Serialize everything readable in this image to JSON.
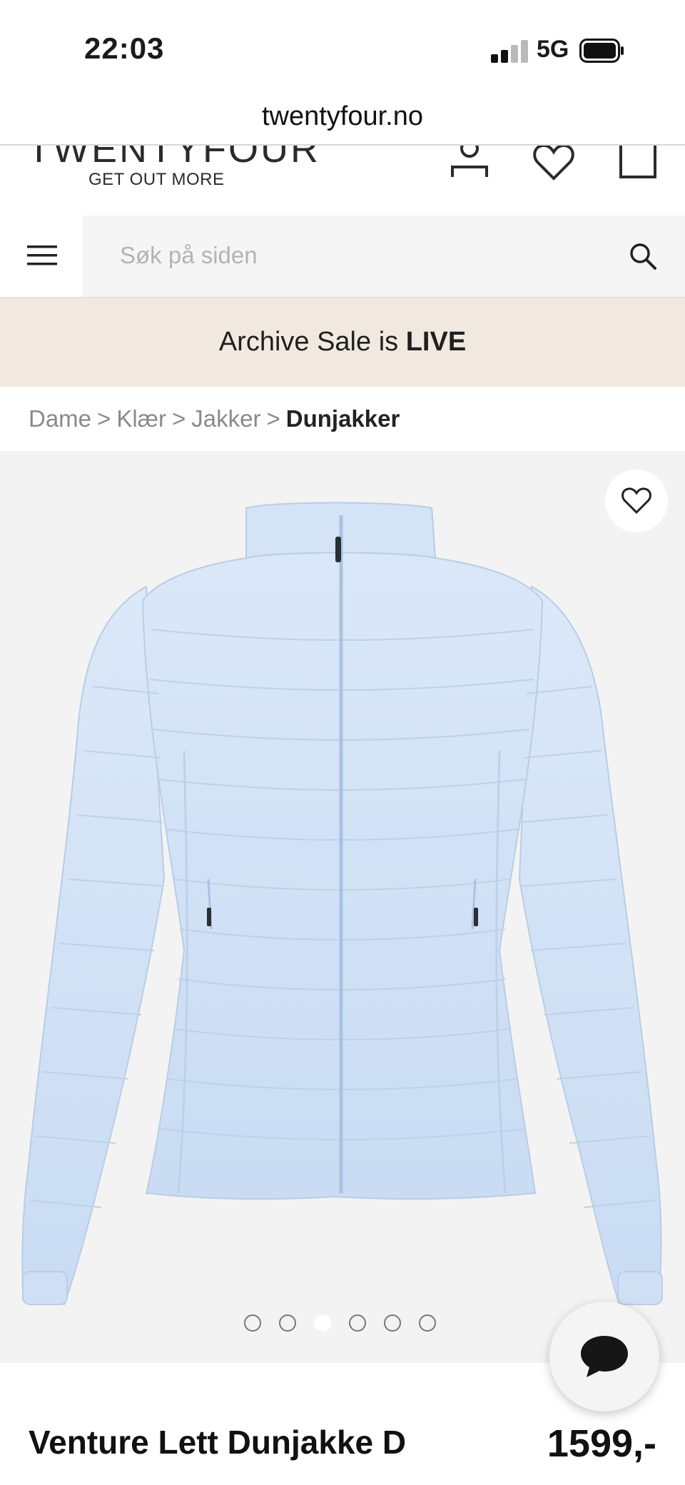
{
  "status_bar": {
    "time": "22:03",
    "network": "5G",
    "icons": [
      "signal-icon",
      "battery-icon"
    ]
  },
  "browser": {
    "url": "twentyfour.no"
  },
  "header": {
    "logo_text": "TWENTYFOUR",
    "tagline": "GET OUT MORE",
    "icons": [
      "account-icon",
      "heart-icon",
      "bag-icon"
    ]
  },
  "search": {
    "placeholder": "Søk på siden",
    "value": "",
    "icons": [
      "menu-icon",
      "search-icon"
    ]
  },
  "banner": {
    "text": "Archive Sale is",
    "highlight": "LIVE",
    "background": "#f1e9e0"
  },
  "breadcrumb": {
    "items": [
      "Dame",
      "Klær",
      "Jakker"
    ],
    "separator": ">",
    "current": "Dunjakker"
  },
  "gallery": {
    "image_count": 6,
    "active_index": 2,
    "product_color": "#cfe0f5",
    "icons": [
      "heart-outline-icon"
    ]
  },
  "chat": {
    "icon": "chat-bubble-icon"
  },
  "product": {
    "name": "Venture Lett Dunjakke D",
    "price": "1599,-"
  }
}
